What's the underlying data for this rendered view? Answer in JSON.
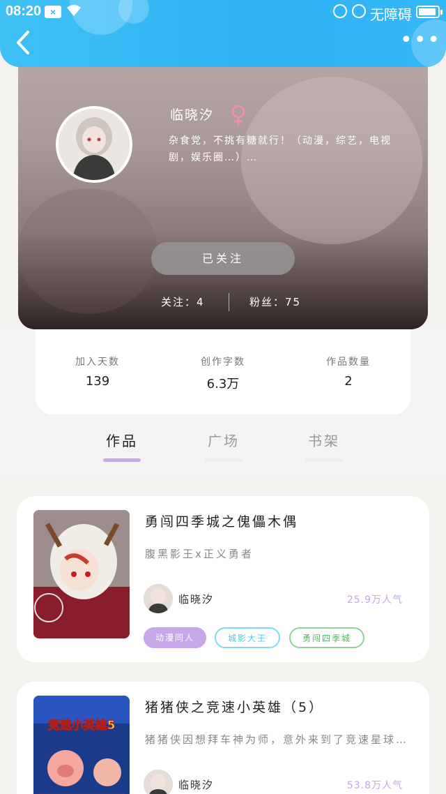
{
  "status_bar": {
    "time": "08:20",
    "accessibility": "无障碍"
  },
  "colors": {
    "header_blue": "#2fb2f6",
    "purple_accent": "#c5a6e6",
    "teal": "#4fd0e8",
    "green": "#6cc47a"
  },
  "header": {
    "back_icon": "chevron-left-icon",
    "more_icon": "more-dots-icon"
  },
  "profile": {
    "nickname": "临晓汐",
    "gender": "female",
    "bio": "杂食党，不挑有糖就行！（动漫，综艺，电视剧，娱乐圈…）…",
    "follow_button": "已关注",
    "following": "关注：4",
    "fans": "粉丝：75"
  },
  "stats": [
    {
      "label": "加入天数",
      "value": "139"
    },
    {
      "label": "创作字数",
      "value": "6.3万"
    },
    {
      "label": "作品数量",
      "value": "2"
    }
  ],
  "tabs": [
    {
      "label": "作品",
      "active": true
    },
    {
      "label": "广场",
      "active": false
    },
    {
      "label": "书架",
      "active": false
    }
  ],
  "works": [
    {
      "title": "勇闯四季城之傀儡木偶",
      "desc": "腹黑影王x正义勇者",
      "author": "临晓汐",
      "popularity": "25.9万人气",
      "tags": [
        "动漫同人",
        "城影大王",
        "勇闯四季城"
      ]
    },
    {
      "title": "猪猪侠之竞速小英雄（5）",
      "desc": "猪猪侠因想拜车神为师，意外来到了竞速星球…",
      "author": "临晓汐",
      "popularity": "53.8万人气",
      "cover_text": "竞速小英雄5"
    }
  ]
}
